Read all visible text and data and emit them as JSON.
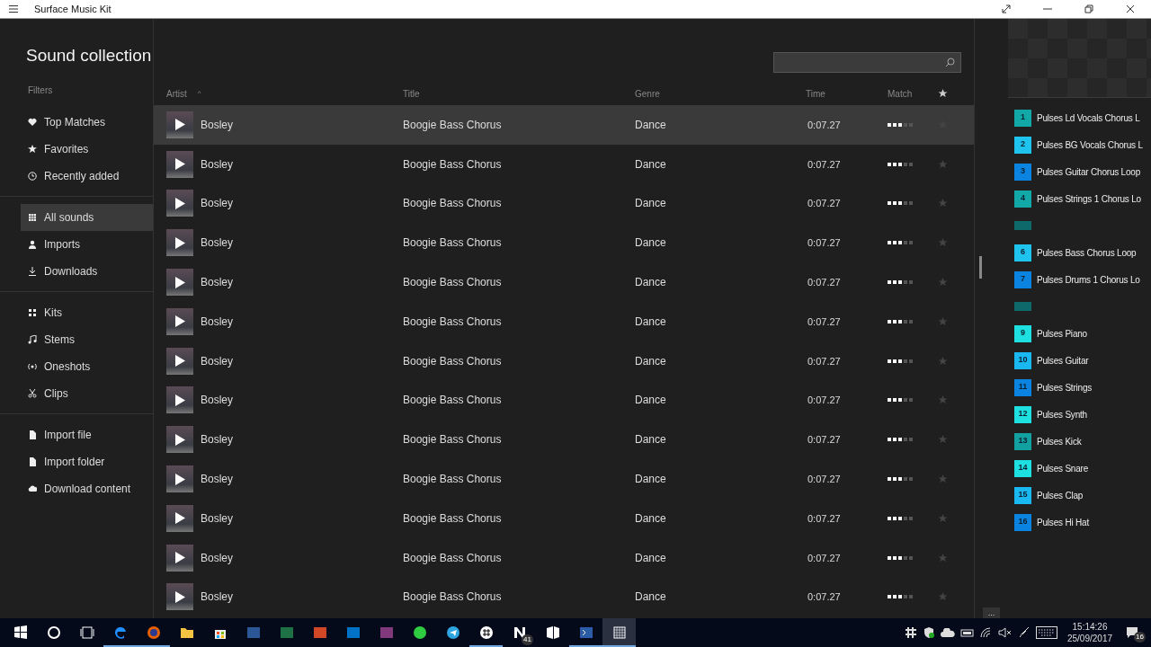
{
  "window": {
    "title": "Surface Music Kit"
  },
  "page_title": "Sound collection",
  "sidebar": {
    "label": "Filters",
    "groups": [
      [
        {
          "label": "Top Matches",
          "selected": false
        },
        {
          "label": "Favorites",
          "selected": false
        },
        {
          "label": "Recently added",
          "selected": false
        }
      ],
      [
        {
          "label": "All sounds",
          "selected": true
        },
        {
          "label": "Imports",
          "selected": false
        },
        {
          "label": "Downloads",
          "selected": false
        }
      ],
      [
        {
          "label": "Kits",
          "selected": false
        },
        {
          "label": "Stems",
          "selected": false
        },
        {
          "label": "Oneshots",
          "selected": false
        },
        {
          "label": "Clips",
          "selected": false
        }
      ],
      [
        {
          "label": "Import file",
          "selected": false
        },
        {
          "label": "Import folder",
          "selected": false
        },
        {
          "label": "Download content",
          "selected": false
        }
      ]
    ]
  },
  "table": {
    "columns": [
      "Artist",
      "Title",
      "Genre",
      "Time",
      "Match"
    ],
    "sort_indicator": "^",
    "rows": [
      {
        "artist": "Bosley",
        "title": "Boogie Bass Chorus",
        "genre": "Dance",
        "time": "0:07.27",
        "level": 0.6,
        "favorite": false,
        "selected": true
      },
      {
        "artist": "Bosley",
        "title": "Boogie Bass Chorus",
        "genre": "Dance",
        "time": "0:07.27",
        "level": 0.6,
        "favorite": false,
        "selected": false
      },
      {
        "artist": "Bosley",
        "title": "Boogie Bass Chorus",
        "genre": "Dance",
        "time": "0:07.27",
        "level": 0.6,
        "favorite": false,
        "selected": false
      },
      {
        "artist": "Bosley",
        "title": "Boogie Bass Chorus",
        "genre": "Dance",
        "time": "0:07.27",
        "level": 0.6,
        "favorite": false,
        "selected": false
      },
      {
        "artist": "Bosley",
        "title": "Boogie Bass Chorus",
        "genre": "Dance",
        "time": "0:07.27",
        "level": 0.6,
        "favorite": false,
        "selected": false
      },
      {
        "artist": "Bosley",
        "title": "Boogie Bass Chorus",
        "genre": "Dance",
        "time": "0:07.27",
        "level": 0.6,
        "favorite": false,
        "selected": false
      },
      {
        "artist": "Bosley",
        "title": "Boogie Bass Chorus",
        "genre": "Dance",
        "time": "0:07.27",
        "level": 0.6,
        "favorite": false,
        "selected": false
      },
      {
        "artist": "Bosley",
        "title": "Boogie Bass Chorus",
        "genre": "Dance",
        "time": "0:07.27",
        "level": 0.6,
        "favorite": false,
        "selected": false
      },
      {
        "artist": "Bosley",
        "title": "Boogie Bass Chorus",
        "genre": "Dance",
        "time": "0:07.27",
        "level": 0.6,
        "favorite": false,
        "selected": false
      },
      {
        "artist": "Bosley",
        "title": "Boogie Bass Chorus",
        "genre": "Dance",
        "time": "0:07.27",
        "level": 0.6,
        "favorite": false,
        "selected": false
      },
      {
        "artist": "Bosley",
        "title": "Boogie Bass Chorus",
        "genre": "Dance",
        "time": "0:07.27",
        "level": 0.6,
        "favorite": false,
        "selected": false
      },
      {
        "artist": "Bosley",
        "title": "Boogie Bass Chorus",
        "genre": "Dance",
        "time": "0:07.27",
        "level": 0.6,
        "favorite": false,
        "selected": false
      },
      {
        "artist": "Bosley",
        "title": "Boogie Bass Chorus",
        "genre": "Dance",
        "time": "0:07.27",
        "level": 0.6,
        "favorite": false,
        "selected": false
      }
    ]
  },
  "pads": [
    {
      "kind": "pad",
      "number": "1",
      "label": "Pulses Ld Vocals Chorus L",
      "color": "#13a8a8"
    },
    {
      "kind": "pad",
      "number": "2",
      "label": "Pulses BG Vocals Chorus L",
      "color": "#1ec3ee"
    },
    {
      "kind": "pad",
      "number": "3",
      "label": "Pulses Guitar Chorus Loop",
      "color": "#0a84e0"
    },
    {
      "kind": "pad",
      "number": "4",
      "label": "Pulses Strings 1 Chorus Lo",
      "color": "#13a8a8"
    },
    {
      "kind": "empty",
      "color": "#0e6a6a"
    },
    {
      "kind": "pad",
      "number": "6",
      "label": "Pulses Bass Chorus Loop",
      "color": "#1ec3ee"
    },
    {
      "kind": "pad",
      "number": "7",
      "label": "Pulses Drums 1 Chorus Lo",
      "color": "#0a84e0"
    },
    {
      "kind": "empty",
      "color": "#0e6a6a"
    },
    {
      "kind": "pad",
      "number": "9",
      "label": "Pulses Piano",
      "color": "#1ee0e0"
    },
    {
      "kind": "pad",
      "number": "10",
      "label": "Pulses Guitar",
      "color": "#1ab8f0"
    },
    {
      "kind": "pad",
      "number": "11",
      "label": "Pulses Strings",
      "color": "#0a84e0"
    },
    {
      "kind": "pad",
      "number": "12",
      "label": "Pulses Synth",
      "color": "#1ee0e0"
    },
    {
      "kind": "pad",
      "number": "13",
      "label": "Pulses Kick",
      "color": "#12a0a0"
    },
    {
      "kind": "pad",
      "number": "14",
      "label": "Pulses Snare",
      "color": "#1ee0e0"
    },
    {
      "kind": "pad",
      "number": "15",
      "label": "Pulses Clap",
      "color": "#1ab8f0"
    },
    {
      "kind": "pad",
      "number": "16",
      "label": "Pulses Hi Hat",
      "color": "#0a84e0"
    }
  ],
  "more_button": "...",
  "taskbar": {
    "apps": [
      {
        "running": false,
        "selected": false
      },
      {
        "running": false,
        "selected": false
      },
      {
        "running": false,
        "selected": false
      },
      {
        "running": true,
        "selected": false
      },
      {
        "running": true,
        "selected": false
      },
      {
        "running": false,
        "selected": false
      },
      {
        "running": false,
        "selected": false
      },
      {
        "running": false,
        "selected": false
      },
      {
        "running": false,
        "selected": false
      },
      {
        "running": false,
        "selected": false
      },
      {
        "running": false,
        "selected": false
      },
      {
        "running": false,
        "selected": false
      },
      {
        "running": false,
        "selected": false
      },
      {
        "running": false,
        "selected": false
      },
      {
        "running": true,
        "selected": false
      },
      {
        "running": false,
        "selected": false,
        "badge": "41"
      },
      {
        "running": false,
        "selected": false
      },
      {
        "running": true,
        "selected": false
      },
      {
        "running": true,
        "selected": true
      }
    ],
    "time": "15:14:26",
    "date": "25/09/2017",
    "notifications": "16"
  }
}
